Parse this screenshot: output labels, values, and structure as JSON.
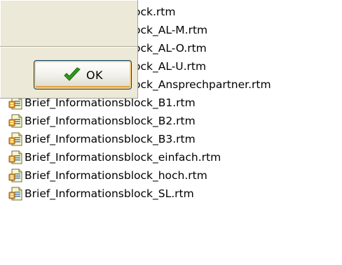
{
  "files": [
    {
      "name": "Brief_Informationsblock.rtm",
      "icon": "rtm-file-icon"
    },
    {
      "name": "Brief_Informationsblock_AL-M.rtm",
      "icon": "rtm-file-icon"
    },
    {
      "name": "Brief_Informationsblock_AL-O.rtm",
      "icon": "rtm-file-icon"
    },
    {
      "name": "Brief_Informationsblock_AL-U.rtm",
      "icon": "rtm-file-icon"
    },
    {
      "name": "Brief_Informationsblock_Ansprechpartner.rtm",
      "icon": "rtm-file-icon"
    },
    {
      "name": "Brief_Informationsblock_B1.rtm",
      "icon": "rtm-file-icon"
    },
    {
      "name": "Brief_Informationsblock_B2.rtm",
      "icon": "rtm-file-icon"
    },
    {
      "name": "Brief_Informationsblock_B3.rtm",
      "icon": "rtm-file-icon"
    },
    {
      "name": "Brief_Informationsblock_einfach.rtm",
      "icon": "rtm-file-icon"
    },
    {
      "name": "Brief_Informationsblock_hoch.rtm",
      "icon": "rtm-file-icon"
    },
    {
      "name": "Brief_Informationsblock_SL.rtm",
      "icon": "rtm-file-icon"
    }
  ],
  "dialog": {
    "ok_label": "OK",
    "ok_icon": "check-icon",
    "background": "#ece9d8"
  },
  "colors": {
    "check_green": "#2f9a1c",
    "button_focus": "#e3a13a"
  }
}
